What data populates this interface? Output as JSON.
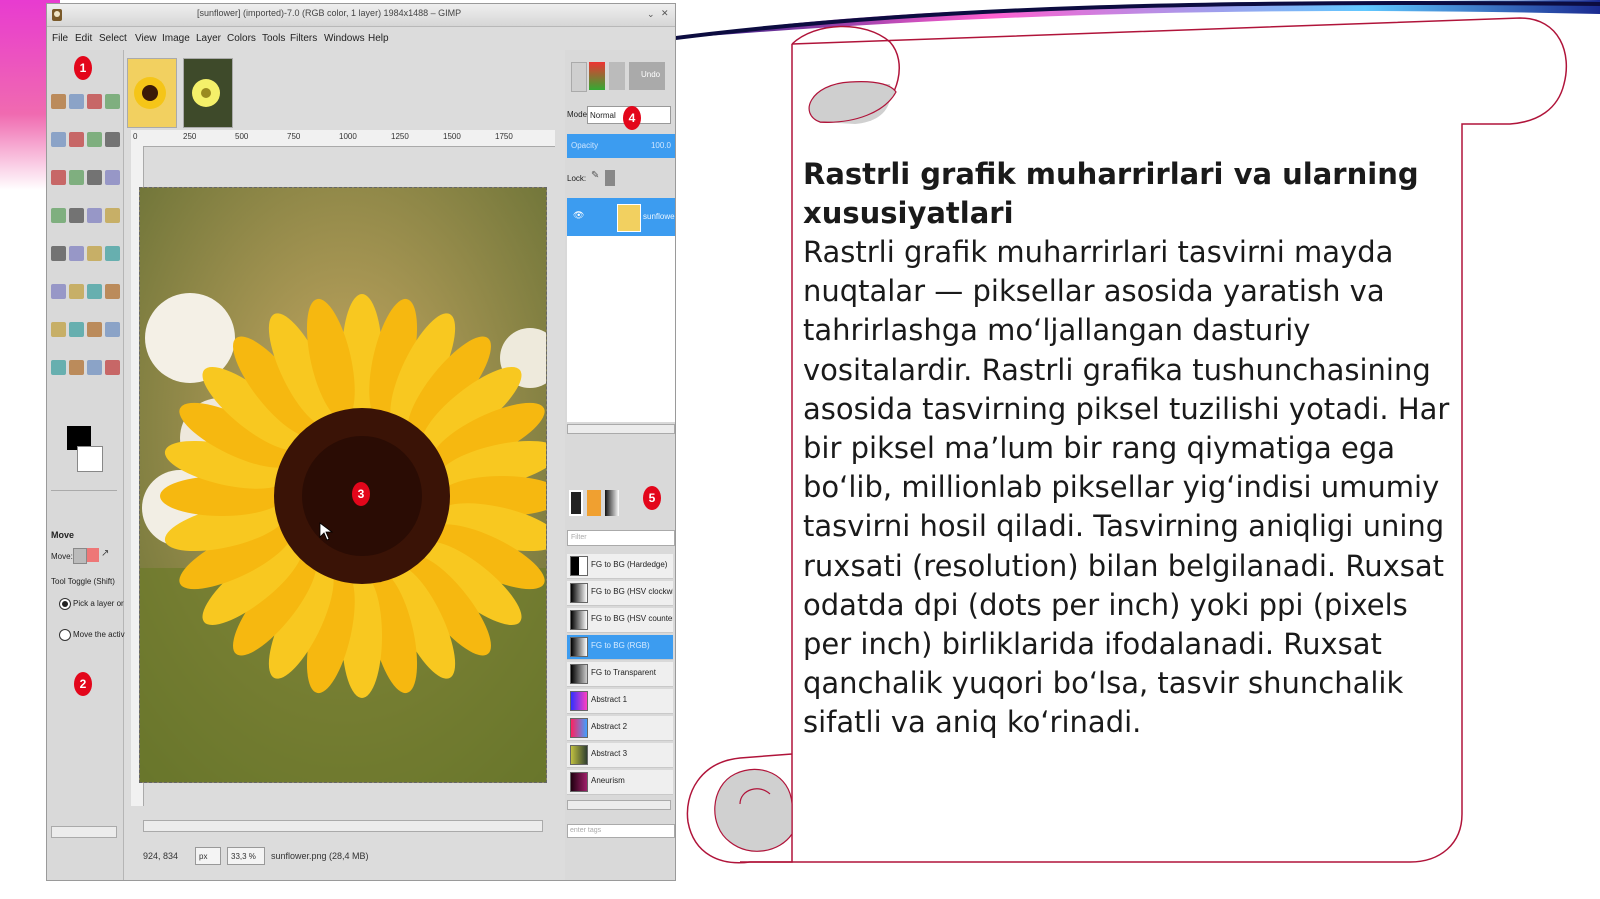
{
  "colors": {
    "accent_red": "#e3061b",
    "panel_border": "#b0143a",
    "gimp_bg": "#dcdcdc",
    "selection_blue": "#3c9cf0"
  },
  "gimp": {
    "title": "[sunflower] (imported)-7.0 (RGB color, 1 layer) 1984x1488 – GIMP",
    "menu": [
      "File",
      "Edit",
      "Select",
      "View",
      "Image",
      "Layer",
      "Colors",
      "Tools",
      "Filters",
      "Windows",
      "Help"
    ],
    "ruler_ticks": [
      "0",
      "250",
      "500",
      "750",
      "1000",
      "1250",
      "1500",
      "1750"
    ],
    "tool_options": {
      "title": "Move",
      "move_label": "Move:",
      "toggle_label": "Tool Toggle (Shift)",
      "option1": "Pick a layer or",
      "option2": "Move the activ"
    },
    "layers": {
      "mode_label": "Mode",
      "mode_value": "Normal",
      "opacity_label": "Opacity",
      "opacity_value": "100.0",
      "lock_label": "Lock:",
      "layer_name": "sunflowe"
    },
    "undo_label": "Undo",
    "gradients": [
      "FG to BG (Hardedge)",
      "FG to BG (HSV clockwise h",
      "FG to BG (HSV counter-clo",
      "FG to BG (RGB)",
      "FG to Transparent",
      "Abstract 1",
      "Abstract 2",
      "Abstract 3",
      "Aneurism"
    ],
    "gradient_filter": "Filter",
    "tag_placeholder": "enter tags",
    "status": {
      "coords": "924, 834",
      "unit": "px",
      "zoom": "33,3 %",
      "file": "sunflower.png (28,4 MB)"
    },
    "markers": [
      "1",
      "2",
      "3",
      "4",
      "5"
    ]
  },
  "slide": {
    "heading": "Rastrli grafik muharrirlari va ularning xususiyatlari",
    "body": "Rastrli grafik muharrirlari tasvirni mayda nuqtalar — piksellar asosida yaratish va tahrirlashga moʻljallangan dasturiy vositalardir. Rastrli grafika tushunchasining asosida tasvirning piksel tuzilishi yotadi. Har bir piksel ma’lum bir rang qiymatiga ega boʻlib, millionlab piksellar yigʻindisi umumiy tasvirni hosil qiladi. Tasvirning aniqligi uning ruxsati (resolution) bilan belgilanadi. Ruxsat odatda dpi (dots per inch) yoki ppi (pixels per inch) birliklarida ifodalanadi. Ruxsat qanchalik yuqori boʻlsa, tasvir shunchalik sifatli va aniq koʻrinadi."
  }
}
